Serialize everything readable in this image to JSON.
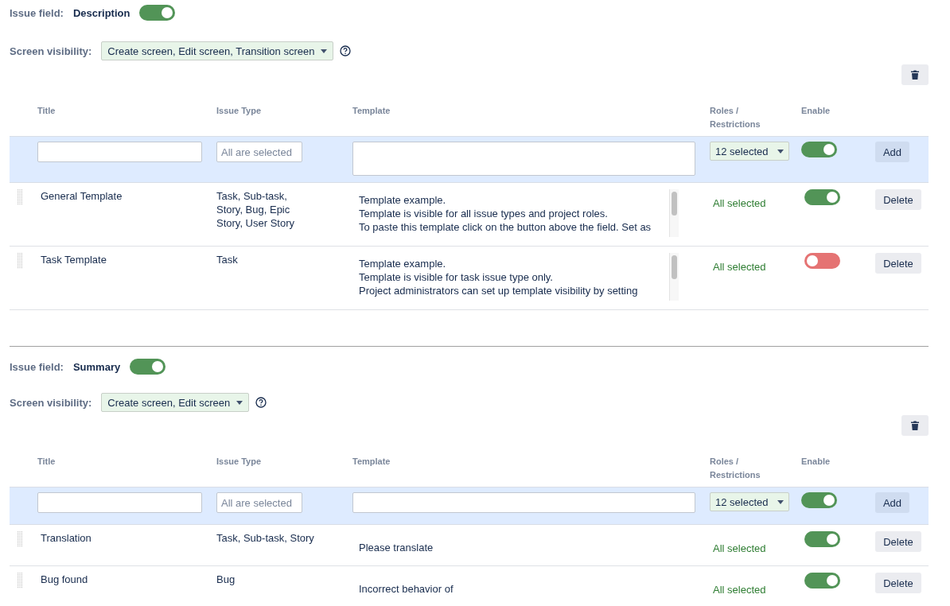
{
  "sections": [
    {
      "field_label": "Issue field:",
      "field_name": "Description",
      "field_on": true,
      "visibility_label": "Screen visibility:",
      "visibility": "Create screen, Edit screen, Transition screen",
      "columns": [
        "Title",
        "Issue Type",
        "Template",
        "Roles /\nRestrictions",
        "Enable"
      ],
      "new_row": {
        "issue_type_placeholder": "All are selected",
        "template_multiline": true,
        "roles": "12 selected",
        "enabled": true,
        "button": "Add"
      },
      "rows": [
        {
          "title": "General Template",
          "issue_type": "Task, Sub-task,\nStory, Bug, Epic\nStory, User Story",
          "template": "Template example.\nTemplate is visible for all issue types and project roles.\nTo paste this template click on the button above the field. Set as",
          "scrollable": true,
          "roles": "All selected",
          "enabled": true,
          "button": "Delete"
        },
        {
          "title": "Task Template",
          "issue_type": "Task",
          "template": "Template example.\nTemplate is visible for task issue type only.\nProject administrators can set up template visibility by setting",
          "scrollable": true,
          "roles": "All selected",
          "enabled": false,
          "button": "Delete"
        }
      ]
    },
    {
      "field_label": "Issue field:",
      "field_name": "Summary",
      "field_on": true,
      "visibility_label": "Screen visibility:",
      "visibility": "Create screen, Edit screen",
      "columns": [
        "Title",
        "Issue Type",
        "Template",
        "Roles /\nRestrictions",
        "Enable"
      ],
      "new_row": {
        "issue_type_placeholder": "All are selected",
        "template_multiline": false,
        "roles": "12 selected",
        "enabled": true,
        "button": "Add"
      },
      "rows": [
        {
          "title": "Translation",
          "issue_type": "Task, Sub-task, Story",
          "template": "Please translate",
          "scrollable": false,
          "roles": "All selected",
          "enabled": true,
          "button": "Delete"
        },
        {
          "title": "Bug found",
          "issue_type": "Bug",
          "template": "Incorrect behavior of",
          "scrollable": false,
          "roles": "All selected",
          "enabled": true,
          "button": "Delete"
        }
      ]
    }
  ]
}
